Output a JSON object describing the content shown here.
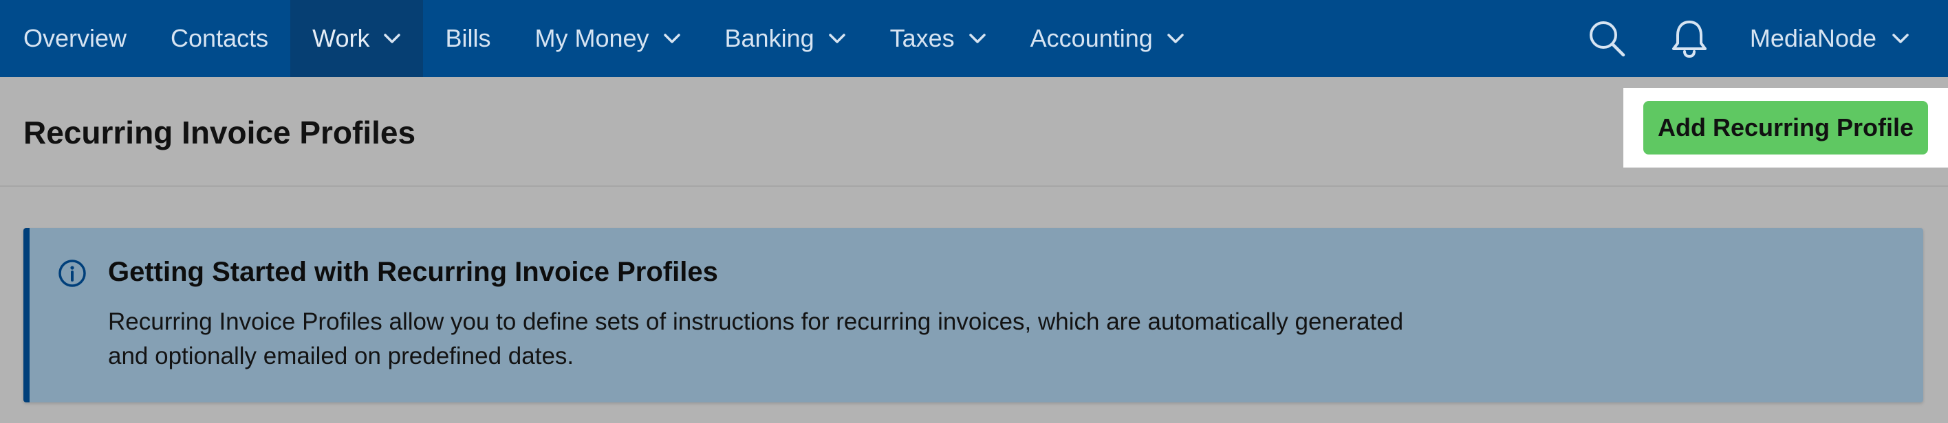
{
  "nav": {
    "items": [
      {
        "label": "Overview",
        "dropdown": false,
        "active": false
      },
      {
        "label": "Contacts",
        "dropdown": false,
        "active": false
      },
      {
        "label": "Work",
        "dropdown": true,
        "active": true
      },
      {
        "label": "Bills",
        "dropdown": false,
        "active": false
      },
      {
        "label": "My Money",
        "dropdown": true,
        "active": false
      },
      {
        "label": "Banking",
        "dropdown": true,
        "active": false
      },
      {
        "label": "Taxes",
        "dropdown": true,
        "active": false
      },
      {
        "label": "Accounting",
        "dropdown": true,
        "active": false
      }
    ],
    "search_icon": "search-icon",
    "notifications_icon": "bell-icon",
    "account_label": "MediaNode"
  },
  "header": {
    "title": "Recurring Invoice Profiles",
    "add_button_label": "Add Recurring Profile"
  },
  "info": {
    "icon": "info-icon",
    "title": "Getting Started with Recurring Invoice Profiles",
    "body": "Recurring Invoice Profiles allow you to define sets of instructions for recurring invoices, which are automatically generated and optionally emailed on predefined dates."
  },
  "colors": {
    "nav_bg": "#004b8c",
    "nav_active_bg": "#063f73",
    "cta_green": "#5fc862",
    "info_bg": "#85a0b4",
    "info_accent": "#003f7a"
  }
}
